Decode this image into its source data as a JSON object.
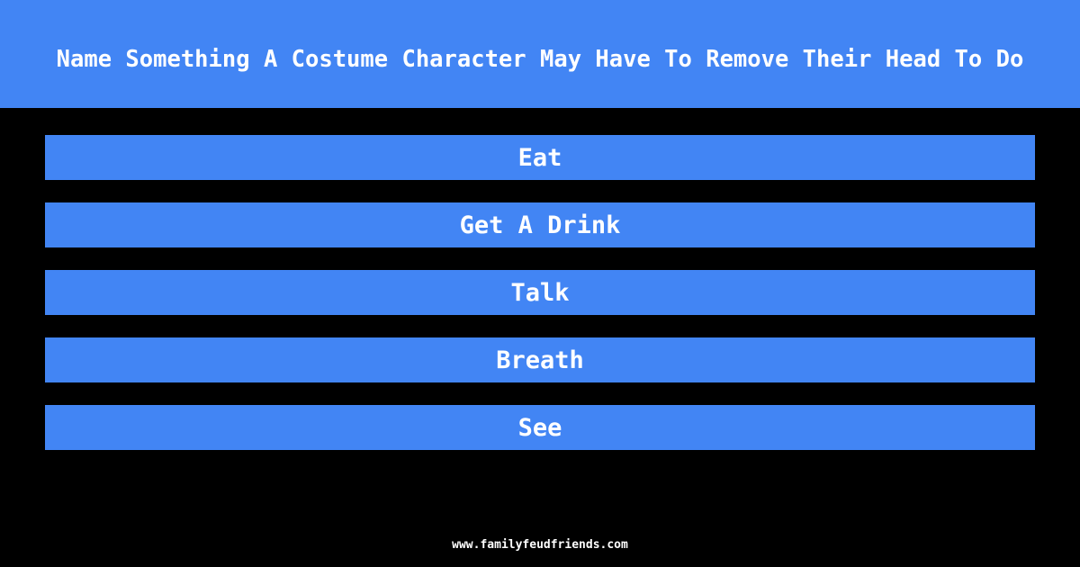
{
  "question": {
    "title": "Name Something A Costume Character May Have To Remove Their Head To Do"
  },
  "answers": [
    {
      "label": "Eat"
    },
    {
      "label": "Get A Drink"
    },
    {
      "label": "Talk"
    },
    {
      "label": "Breath"
    },
    {
      "label": "See"
    }
  ],
  "footer": {
    "site": "www.familyfeudfriends.com"
  },
  "colors": {
    "accent": "#4285f4",
    "background": "#000000",
    "text": "#ffffff"
  }
}
